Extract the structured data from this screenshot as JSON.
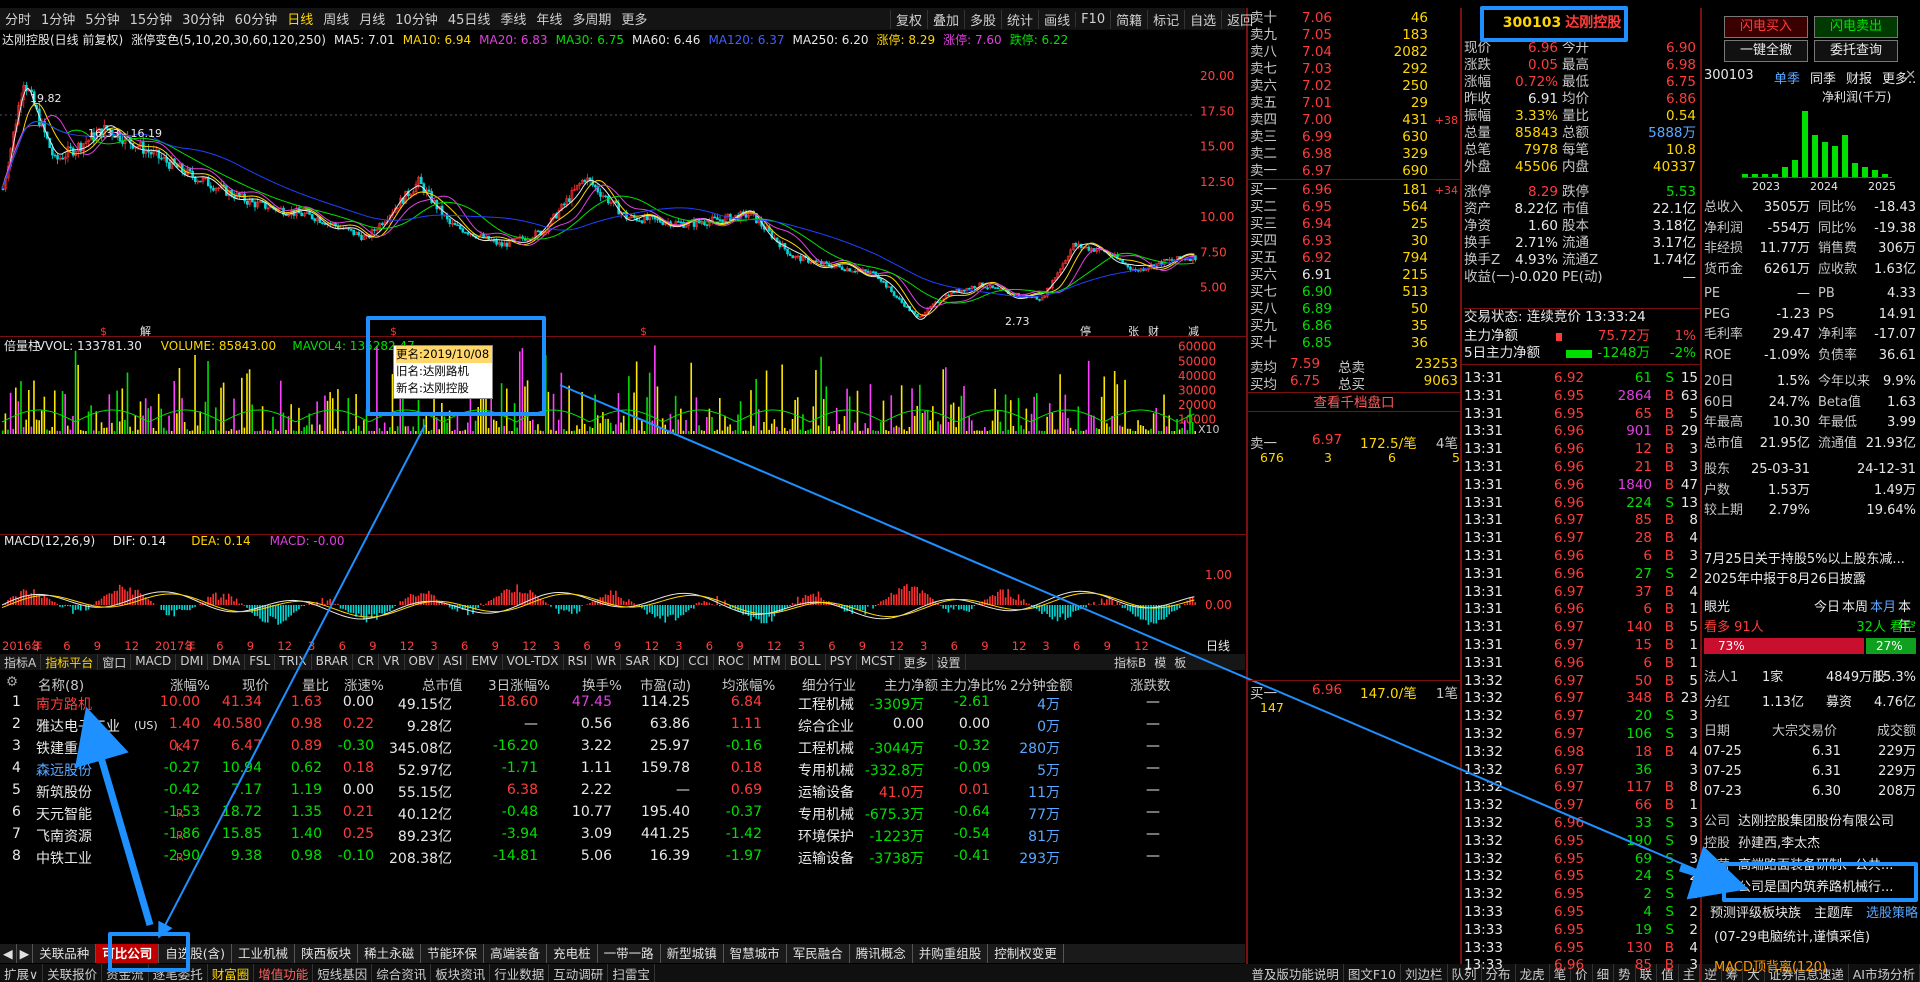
{
  "toolbar": {
    "periods": [
      "分时",
      "1分钟",
      "5分钟",
      "15分钟",
      "30分钟",
      "60分钟",
      "日线",
      "周线",
      "月线",
      "10分钟",
      "45日线",
      "季线",
      "年线",
      "多周期",
      "更多"
    ],
    "active": "日线",
    "right": [
      "复权",
      "叠加",
      "多股",
      "统计",
      "画线",
      "F10",
      "简籍",
      "标记",
      "自选",
      "返回"
    ]
  },
  "kline": {
    "legend": [
      {
        "t": "达刚控股(日线 前复权)",
        "c": "#e8e8e8"
      },
      {
        "t": "涨停变色(5,10,20,30,60,120,250)",
        "c": "#e8e8e8"
      },
      {
        "t": "MA5: 7.01",
        "c": "#e8e8e8"
      },
      {
        "t": "MA10: 6.94",
        "c": "#ffd700"
      },
      {
        "t": "MA20: 6.83",
        "c": "#e040e0"
      },
      {
        "t": "MA30: 6.75",
        "c": "#00e000"
      },
      {
        "t": "MA60: 6.46",
        "c": "#e8e8e8"
      },
      {
        "t": "MA120: 6.37",
        "c": "#4060ff"
      },
      {
        "t": "MA250: 6.20",
        "c": "#e8e8e8"
      },
      {
        "t": "涨停: 8.29",
        "c": "#ffd700"
      },
      {
        "t": "涨停: 7.60",
        "c": "#e040e0"
      },
      {
        "t": "跌停: 6.22",
        "c": "#00e000"
      }
    ],
    "high": "19.82",
    "range": "16.33 - 16.19",
    "low": "2.73",
    "yticks": [
      "20.00",
      "17.50",
      "15.00",
      "12.50",
      "10.00",
      "7.50",
      "5.00"
    ],
    "marks": [
      "解",
      "停",
      "张",
      "财"
    ]
  },
  "volume": {
    "legend": [
      {
        "t": "倍量柱",
        "c": "#e8e8e8"
      },
      {
        "t": "VVOL: 133781.30",
        "c": "#e8e8e8"
      },
      {
        "t": "VOLUME: 85843.00",
        "c": "#ffd700"
      },
      {
        "t": "MAVOL4: 135282.47",
        "c": "#00e000"
      }
    ],
    "yticks": [
      "60000",
      "50000",
      "40000",
      "30000",
      "20000",
      "10000"
    ],
    "unit": "X10"
  },
  "macd": {
    "legend": [
      {
        "t": "MACD(12,26,9)",
        "c": "#e8e8e8"
      },
      {
        "t": "DIF: 0.14",
        "c": "#e8e8e8"
      },
      {
        "t": "DEA: 0.14",
        "c": "#ffd700"
      },
      {
        "t": "MACD: -0.00",
        "c": "#e040e0"
      }
    ],
    "yticks": [
      "1.00",
      "0.00"
    ]
  },
  "xaxis": {
    "labels": [
      "2016年",
      "3",
      "6",
      "9",
      "12",
      "2017年",
      "3",
      "6",
      "9",
      "12",
      "3",
      "6",
      "9",
      "12",
      "3",
      "6",
      "9",
      "12",
      "3",
      "6",
      "9",
      "12",
      "3",
      "6",
      "9",
      "12",
      "3",
      "6",
      "9",
      "12",
      "3",
      "6",
      "9",
      "12",
      "3",
      "6",
      "9",
      "12"
    ],
    "period": "日线"
  },
  "tooltip": {
    "title": "更名:2019/10/08",
    "old": "旧名:达刚路机",
    "new": "新名:达刚控股"
  },
  "indicators": [
    "指标A",
    "指标平台",
    "窗口",
    "MACD",
    "DMI",
    "DMA",
    "FSL",
    "TRIX",
    "BRAR",
    "CR",
    "VR",
    "OBV",
    "ASI",
    "EMV",
    "VOL-TDX",
    "RSI",
    "WR",
    "SAR",
    "KDJ",
    "CCI",
    "ROC",
    "MTM",
    "BOLL",
    "PSY",
    "MCST",
    "更多",
    "设置"
  ],
  "indicators_right": [
    "指标B",
    "模",
    "板"
  ],
  "book": {
    "sell": [
      [
        "卖十",
        "7.06",
        "46"
      ],
      [
        "卖九",
        "7.05",
        "183"
      ],
      [
        "卖八",
        "7.04",
        "2082"
      ],
      [
        "卖七",
        "7.03",
        "292"
      ],
      [
        "卖六",
        "7.02",
        "250"
      ],
      [
        "卖五",
        "7.01",
        "29"
      ],
      [
        "卖四",
        "7.00",
        "431",
        "+38"
      ],
      [
        "卖三",
        "6.99",
        "630"
      ],
      [
        "卖二",
        "6.98",
        "329"
      ],
      [
        "卖一",
        "6.97",
        "690"
      ]
    ],
    "buy": [
      [
        "买一",
        "6.96",
        "181",
        "+34"
      ],
      [
        "买二",
        "6.95",
        "564"
      ],
      [
        "买三",
        "6.94",
        "25"
      ],
      [
        "买四",
        "6.93",
        "30"
      ],
      [
        "买五",
        "6.92",
        "794"
      ],
      [
        "买六",
        "6.91",
        "215"
      ],
      [
        "买七",
        "6.90",
        "513"
      ],
      [
        "买八",
        "6.89",
        "50"
      ],
      [
        "买九",
        "6.86",
        "35"
      ],
      [
        "买十",
        "6.85",
        "36"
      ]
    ],
    "avg_sell": [
      "卖均",
      "7.59",
      "总卖",
      "23253"
    ],
    "avg_buy": [
      "买均",
      "6.75",
      "总买",
      "9063"
    ],
    "depth_btn": "查看千档盘口",
    "q1": [
      "卖一",
      "6.97",
      "172.5/笔",
      "4笔"
    ],
    "q1v": [
      "676",
      "3",
      "6",
      "5"
    ],
    "q2": [
      "买一",
      "6.96",
      "147.0/笔",
      "1笔"
    ],
    "q2v": [
      "147"
    ]
  },
  "quote": {
    "code": "300103",
    "name": "达刚控股",
    "rows": [
      [
        "现价",
        "6.96",
        "今开",
        "6.90"
      ],
      [
        "涨跌",
        "0.05",
        "最高",
        "6.98"
      ],
      [
        "涨幅",
        "0.72%",
        "最低",
        "6.75"
      ],
      [
        "昨收",
        "6.91",
        "均价",
        "6.86"
      ],
      [
        "振幅",
        "3.33%",
        "量比",
        "0.54"
      ],
      [
        "总量",
        "85843",
        "总额",
        "5888万"
      ],
      [
        "总笔",
        "7978",
        "每笔",
        "10.8"
      ],
      [
        "外盘",
        "45506",
        "内盘",
        "40337"
      ],
      [
        "涨停",
        "8.29",
        "跌停",
        "5.53"
      ],
      [
        "资产",
        "8.22亿",
        "市值",
        "22.1亿"
      ],
      [
        "净资",
        "1.60",
        "股本",
        "3.18亿"
      ],
      [
        "换手",
        "2.71%",
        "流通",
        "3.17亿"
      ],
      [
        "换手Z",
        "4.93%",
        "流通Z",
        "1.74亿"
      ],
      [
        "收益(一)",
        "-0.020",
        "PE(动)",
        "—"
      ]
    ],
    "status": "交易状态: 连续竞价 13:33:24",
    "flow": [
      [
        "主力净额",
        "75.72万",
        "1%"
      ],
      [
        "5日主力净额",
        "-1248万",
        "-2%"
      ]
    ],
    "ticks": [
      [
        "13:31",
        "6.92",
        "61",
        "S",
        "15"
      ],
      [
        "13:31",
        "6.95",
        "2864",
        "B",
        "63"
      ],
      [
        "13:31",
        "6.95",
        "65",
        "B",
        "5"
      ],
      [
        "13:31",
        "6.96",
        "901",
        "B",
        "29"
      ],
      [
        "13:31",
        "6.96",
        "12",
        "B",
        "3"
      ],
      [
        "13:31",
        "6.96",
        "21",
        "B",
        "3"
      ],
      [
        "13:31",
        "6.96",
        "1840",
        "B",
        "47"
      ],
      [
        "13:31",
        "6.96",
        "224",
        "S",
        "13"
      ],
      [
        "13:31",
        "6.97",
        "85",
        "B",
        "8"
      ],
      [
        "13:31",
        "6.97",
        "28",
        "B",
        "4"
      ],
      [
        "13:31",
        "6.96",
        "6",
        "B",
        "3"
      ],
      [
        "13:31",
        "6.96",
        "27",
        "S",
        "2"
      ],
      [
        "13:31",
        "6.97",
        "37",
        "B",
        "4"
      ],
      [
        "13:31",
        "6.96",
        "6",
        "B",
        "1"
      ],
      [
        "13:31",
        "6.97",
        "140",
        "B",
        "5"
      ],
      [
        "13:31",
        "6.97",
        "15",
        "B",
        "1"
      ],
      [
        "13:31",
        "6.96",
        "6",
        "B",
        "1"
      ],
      [
        "13:32",
        "6.97",
        "50",
        "B",
        "5"
      ],
      [
        "13:32",
        "6.97",
        "348",
        "B",
        "23"
      ],
      [
        "13:32",
        "6.97",
        "20",
        "S",
        "3"
      ],
      [
        "13:32",
        "6.97",
        "106",
        "S",
        "3"
      ],
      [
        "13:32",
        "6.98",
        "18",
        "B",
        "4"
      ],
      [
        "13:32",
        "6.97",
        "36",
        "",
        "3"
      ],
      [
        "13:32",
        "6.97",
        "117",
        "B",
        "8"
      ],
      [
        "13:32",
        "6.97",
        "66",
        "B",
        "1"
      ],
      [
        "13:32",
        "6.96",
        "33",
        "S",
        "3"
      ],
      [
        "13:32",
        "6.95",
        "190",
        "S",
        "9"
      ],
      [
        "13:32",
        "6.95",
        "69",
        "S",
        "3"
      ],
      [
        "13:32",
        "6.95",
        "24",
        "S",
        "2"
      ],
      [
        "13:32",
        "6.95",
        "2",
        "S",
        "1"
      ],
      [
        "13:33",
        "6.95",
        "4",
        "S",
        "2"
      ],
      [
        "13:33",
        "6.95",
        "19",
        "S",
        "2"
      ],
      [
        "13:33",
        "6.95",
        "130",
        "B",
        "4"
      ],
      [
        "13:33",
        "6.96",
        "85",
        "B",
        "3"
      ]
    ]
  },
  "right": {
    "buttons": [
      "闪电买入",
      "闪电卖出",
      "一键全撤",
      "委托查询"
    ],
    "code": "300103",
    "tabs": [
      "单季",
      "同季",
      "财报",
      "更多.."
    ],
    "chart_title": "净利润(千万)",
    "bars": [
      0.05,
      0.05,
      0.05,
      0.05,
      0.15,
      0.25,
      0.95,
      0.6,
      0.5,
      0.45,
      0.6,
      0.2,
      0.15,
      0.1,
      0.05
    ],
    "bar_years": [
      "2023",
      "2024",
      "2025"
    ],
    "fin": [
      [
        "总收入",
        "3505万",
        "同比%",
        "-18.43"
      ],
      [
        "净利润",
        "-554万",
        "同比%",
        "-19.38"
      ],
      [
        "非经损",
        "11.77万",
        "销售费",
        "306万"
      ],
      [
        "货币金",
        "6261万",
        "应收款",
        "1.63亿"
      ],
      [
        "PE",
        "—",
        "PB",
        "4.33"
      ],
      [
        "PEG",
        "-1.23",
        "PS",
        "14.91"
      ],
      [
        "毛利率",
        "29.47",
        "净利率",
        "-17.07"
      ],
      [
        "ROE",
        "-1.09%",
        "负债率",
        "36.61"
      ],
      [
        "20日",
        "1.5%",
        "今年以来",
        "9.9%"
      ],
      [
        "60日",
        "24.7%",
        "Beta值",
        "1.63"
      ],
      [
        "年最高",
        "10.30",
        "年最低",
        "3.99"
      ],
      [
        "总市值",
        "21.95亿",
        "流通值",
        "21.93亿"
      ],
      [
        "股东",
        "25-03-31",
        "",
        "24-12-31"
      ],
      [
        "户数",
        "1.53万",
        "",
        "1.49万"
      ],
      [
        "较上期",
        "2.79%",
        "",
        "19.64%"
      ]
    ],
    "news": [
      "7月25日关于持股5%以上股东减...",
      "2025年中报于8月26日披露"
    ],
    "eye": {
      "label": "眼光",
      "periods": [
        "今日",
        "本周",
        "本月",
        "本年"
      ],
      "bull": "看多 91人",
      "bear": "32人 看空",
      "bull_pct": "73%",
      "bear_pct": "27%"
    },
    "holders": [
      [
        "法人1",
        "1家",
        "4849万股",
        "15.3%"
      ],
      [
        "分红",
        "1.13亿",
        "募资",
        "4.76亿"
      ]
    ],
    "block_head": [
      "日期",
      "大宗交易价",
      "成交额"
    ],
    "block": [
      [
        "07-25",
        "6.31",
        "229万"
      ],
      [
        "07-25",
        "6.31",
        "229万"
      ],
      [
        "07-23",
        "6.30",
        "208万"
      ]
    ],
    "company": [
      [
        "公司",
        "达刚控股集团股份有限公司"
      ],
      [
        "控股",
        "孙建西,李太杰"
      ],
      [
        "主营",
        "高端路面装备研制、公共..."
      ],
      [
        "地位",
        "公司是国内筑养路机械行..."
      ]
    ],
    "links": [
      "预测评级",
      "板块族",
      "主题库",
      "选股策略"
    ],
    "notice": "(07-29电脑统计,谨慎采信)",
    "macd_note": "MACD顶背离(120)"
  },
  "table": {
    "headers": [
      "名称(8)",
      "涨幅%",
      "现价",
      "量比",
      "涨速%",
      "总市值",
      "3日涨幅%",
      "换手%",
      "市盈(动)",
      "均涨幅%",
      "细分行业",
      "主力净额",
      "主力净比%",
      "2分钟金额",
      "涨跌数"
    ],
    "rows": [
      {
        "n": "1",
        "name": "南方路机",
        "flag": "",
        "nc": "#ff3c3c",
        "v": [
          "10.00",
          "41.34",
          "1.63",
          "0.00",
          "49.15亿",
          "18.60",
          "47.45",
          "114.25",
          "6.84",
          "工程机械",
          "-3309万",
          "-2.61",
          "4万",
          "—"
        ]
      },
      {
        "n": "2",
        "name": "雅达电子工业",
        "flag": "(US)",
        "nc": "#e8e8e8",
        "v": [
          "1.40",
          "40.580",
          "0.98",
          "0.22",
          "9.28亿",
          "—",
          "0.56",
          "63.86",
          "1.11",
          "综合企业",
          "0.00",
          "0.00",
          "0万",
          "—"
        ]
      },
      {
        "n": "3",
        "name": "铁建重工",
        "flag": "K",
        "nc": "#e8e8e8",
        "v": [
          "0.47",
          "6.47",
          "0.89",
          "-0.30",
          "345.08亿",
          "-16.20",
          "3.22",
          "25.97",
          "-0.16",
          "工程机械",
          "-3044万",
          "-0.32",
          "280万",
          "—"
        ]
      },
      {
        "n": "4",
        "name": "森远股份",
        "flag": "",
        "nc": "#5aa8ff",
        "v": [
          "-0.27",
          "10.94",
          "0.62",
          "0.18",
          "52.97亿",
          "-1.71",
          "1.11",
          "159.78",
          "0.18",
          "专用机械",
          "-332.8万",
          "-0.09",
          "5万",
          "—"
        ]
      },
      {
        "n": "5",
        "name": "新筑股份",
        "flag": "",
        "nc": "#e8e8e8",
        "v": [
          "-0.42",
          "7.17",
          "1.19",
          "0.00",
          "55.15亿",
          "6.38",
          "2.22",
          "—",
          "0.69",
          "运输设备",
          "41.0万",
          "0.01",
          "11万",
          "—"
        ]
      },
      {
        "n": "6",
        "name": "天元智能",
        "flag": "R",
        "nc": "#e8e8e8",
        "v": [
          "-1.53",
          "18.72",
          "1.35",
          "0.21",
          "40.12亿",
          "-0.48",
          "10.77",
          "195.40",
          "-0.37",
          "专用机械",
          "-675.3万",
          "-0.64",
          "77万",
          "—"
        ]
      },
      {
        "n": "7",
        "name": "飞南资源",
        "flag": "R",
        "nc": "#e8e8e8",
        "v": [
          "-1.86",
          "15.85",
          "1.40",
          "0.25",
          "89.23亿",
          "-3.94",
          "3.09",
          "441.25",
          "-1.42",
          "环境保护",
          "-1223万",
          "-0.54",
          "81万",
          "—"
        ]
      },
      {
        "n": "8",
        "name": "中铁工业",
        "flag": "R",
        "nc": "#e8e8e8",
        "v": [
          "-2.90",
          "9.38",
          "0.98",
          "-0.10",
          "208.38亿",
          "-14.81",
          "5.06",
          "16.39",
          "-1.97",
          "运输设备",
          "-3738万",
          "-0.41",
          "293万",
          "—"
        ]
      }
    ]
  },
  "tabs": [
    "关联品种",
    "可比公司",
    "自选股(含)",
    "工业机械",
    "陕西板块",
    "稀土永磁",
    "节能环保",
    "高端装备",
    "充电桩",
    "一带一路",
    "新型城镇",
    "智慧城市",
    "军民融合",
    "腾讯概念",
    "并购重组股",
    "控制权变更"
  ],
  "footer": [
    "扩展∨",
    "关联报价",
    "资金流",
    "逐笔委托",
    "财富圈",
    "增值功能",
    "短线基因",
    "综合资讯",
    "板块资讯",
    "行业数据",
    "互动调研",
    "扫雷宝"
  ],
  "footer_right": [
    "普及版功能说明",
    "图文F10",
    "刘边栏",
    "队列",
    "分布",
    "龙虎",
    "笔",
    "价",
    "细",
    "势",
    "联",
    "值",
    "主",
    "逆",
    "筹",
    "大",
    "证券信息速递",
    "AI市场分析"
  ]
}
